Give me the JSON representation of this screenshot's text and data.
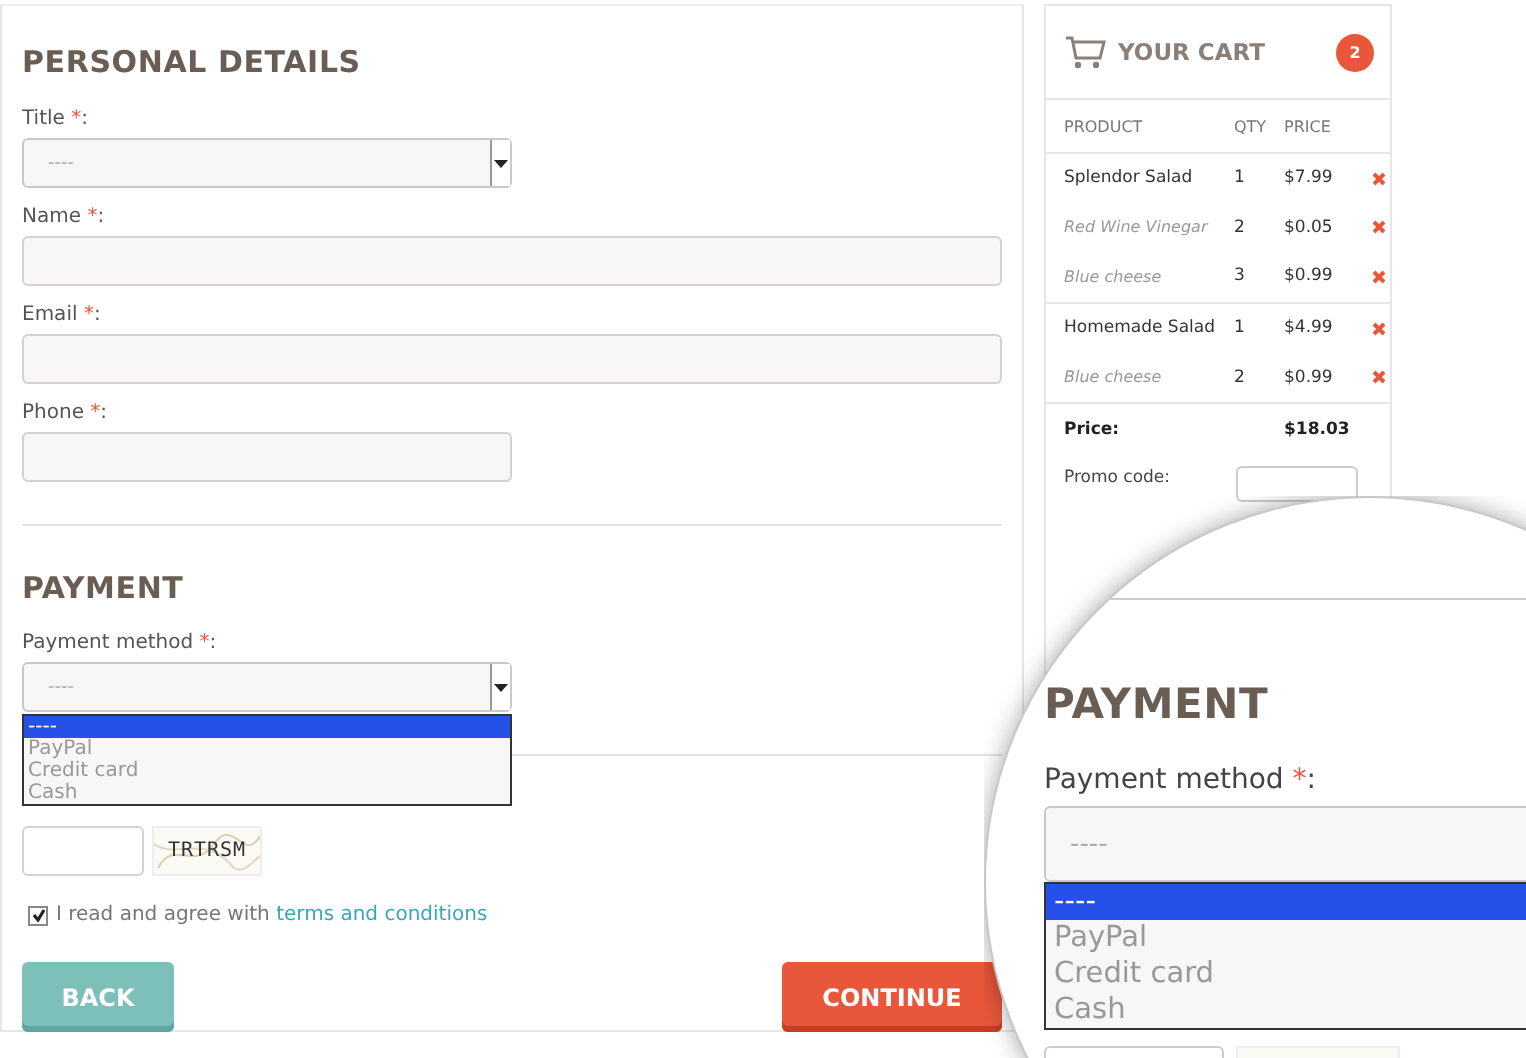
{
  "personal": {
    "heading": "PERSONAL DETAILS",
    "fields": [
      {
        "label": "Title",
        "required_mark": "*",
        "label_end": ":",
        "kind": "select",
        "placeholder": "----"
      },
      {
        "label": "Name",
        "required_mark": "*",
        "label_end": ":",
        "kind": "text"
      },
      {
        "label": "Email",
        "required_mark": "*",
        "label_end": ":",
        "kind": "email"
      },
      {
        "label": "Phone",
        "required_mark": "*",
        "label_end": ":",
        "kind": "phone"
      }
    ]
  },
  "payment": {
    "heading": "PAYMENT",
    "label": "Payment method",
    "required_mark": "*",
    "label_end": ":",
    "placeholder": "----",
    "options": [
      {
        "label": "----",
        "selected": true
      },
      {
        "label": "PayPal",
        "selected": false
      },
      {
        "label": "Credit card",
        "selected": false
      },
      {
        "label": "Cash",
        "selected": false
      }
    ]
  },
  "captcha": {
    "image_text": "TRTRSM"
  },
  "agreement": {
    "checked": true,
    "text": "I read and agree with",
    "link": "terms and conditions"
  },
  "buttons": [
    {
      "label": "BACK",
      "kind": "back"
    },
    {
      "label": "CONTINUE",
      "kind": "continue"
    }
  ],
  "cart": {
    "title": "YOUR CART",
    "count": "2",
    "columns": [
      "PRODUCT",
      "QTY",
      "PRICE"
    ],
    "groups": [
      {
        "items": [
          {
            "name": "Splendor Salad",
            "qty": "1",
            "price": "$7.99",
            "kind": "main"
          },
          {
            "name": "Red Wine Vinegar",
            "qty": "2",
            "price": "$0.05",
            "kind": "extra"
          },
          {
            "name": "Blue cheese",
            "qty": "3",
            "price": "$0.99",
            "kind": "extra"
          }
        ]
      },
      {
        "items": [
          {
            "name": "Homemade Salad",
            "qty": "1",
            "price": "$4.99",
            "kind": "main"
          },
          {
            "name": "Blue cheese",
            "qty": "2",
            "price": "$0.99",
            "kind": "extra"
          }
        ]
      }
    ],
    "total_label": "Price:",
    "total": "$18.03",
    "promo_label": "Promo code:"
  },
  "magnifier": {
    "heading": "PAYMENT",
    "label": "Payment method",
    "required_mark": "*",
    "label_end": ":",
    "placeholder": "----",
    "options": [
      {
        "label": "----",
        "selected": true
      },
      {
        "label": "PayPal",
        "selected": false
      },
      {
        "label": "Credit card",
        "selected": false
      },
      {
        "label": "Cash",
        "selected": false
      }
    ]
  }
}
